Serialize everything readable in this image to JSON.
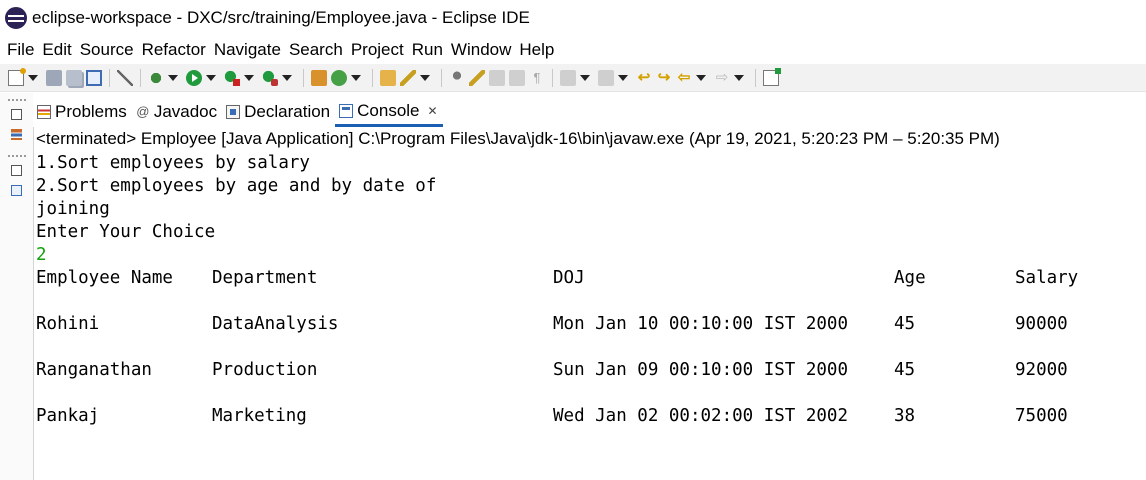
{
  "window": {
    "title": "eclipse-workspace - DXC/src/training/Employee.java - Eclipse IDE"
  },
  "menu": [
    "File",
    "Edit",
    "Source",
    "Refactor",
    "Navigate",
    "Search",
    "Project",
    "Run",
    "Window",
    "Help"
  ],
  "tabs": [
    {
      "label": "Problems",
      "icon": "problems-icon"
    },
    {
      "label": "Javadoc",
      "icon": "javadoc-icon",
      "glyph": "@"
    },
    {
      "label": "Declaration",
      "icon": "declaration-icon"
    },
    {
      "label": "Console",
      "icon": "console-icon",
      "active": true,
      "close": "✕"
    }
  ],
  "console": {
    "status": "<terminated> Employee [Java Application] C:\\Program Files\\Java\\jdk-16\\bin\\javaw.exe  (Apr 19, 2021, 5:20:23 PM – 5:20:35 PM)",
    "output_lines": [
      "1.Sort employees by salary",
      "2.Sort employees by age and by date of",
      "joining",
      "Enter Your Choice"
    ],
    "user_input": "2",
    "input_color": "#13a10e",
    "table": {
      "headers": [
        "Employee Name",
        "Department",
        "DOJ",
        "Age",
        "Salary"
      ],
      "rows": [
        [
          "Rohini",
          "DataAnalysis",
          "Mon Jan 10 00:10:00 IST 2000",
          "45",
          "90000"
        ],
        [
          "Ranganathan",
          "Production",
          "Sun Jan 09 00:10:00 IST 2000",
          "45",
          "92000"
        ],
        [
          "Pankaj",
          "Marketing",
          "Wed Jan 02 00:02:00 IST 2002",
          "38",
          "75000"
        ]
      ]
    }
  },
  "colors": {
    "active_tab_underline": "#1a5fb4",
    "toolbar_bg": "#f2f2f2"
  }
}
